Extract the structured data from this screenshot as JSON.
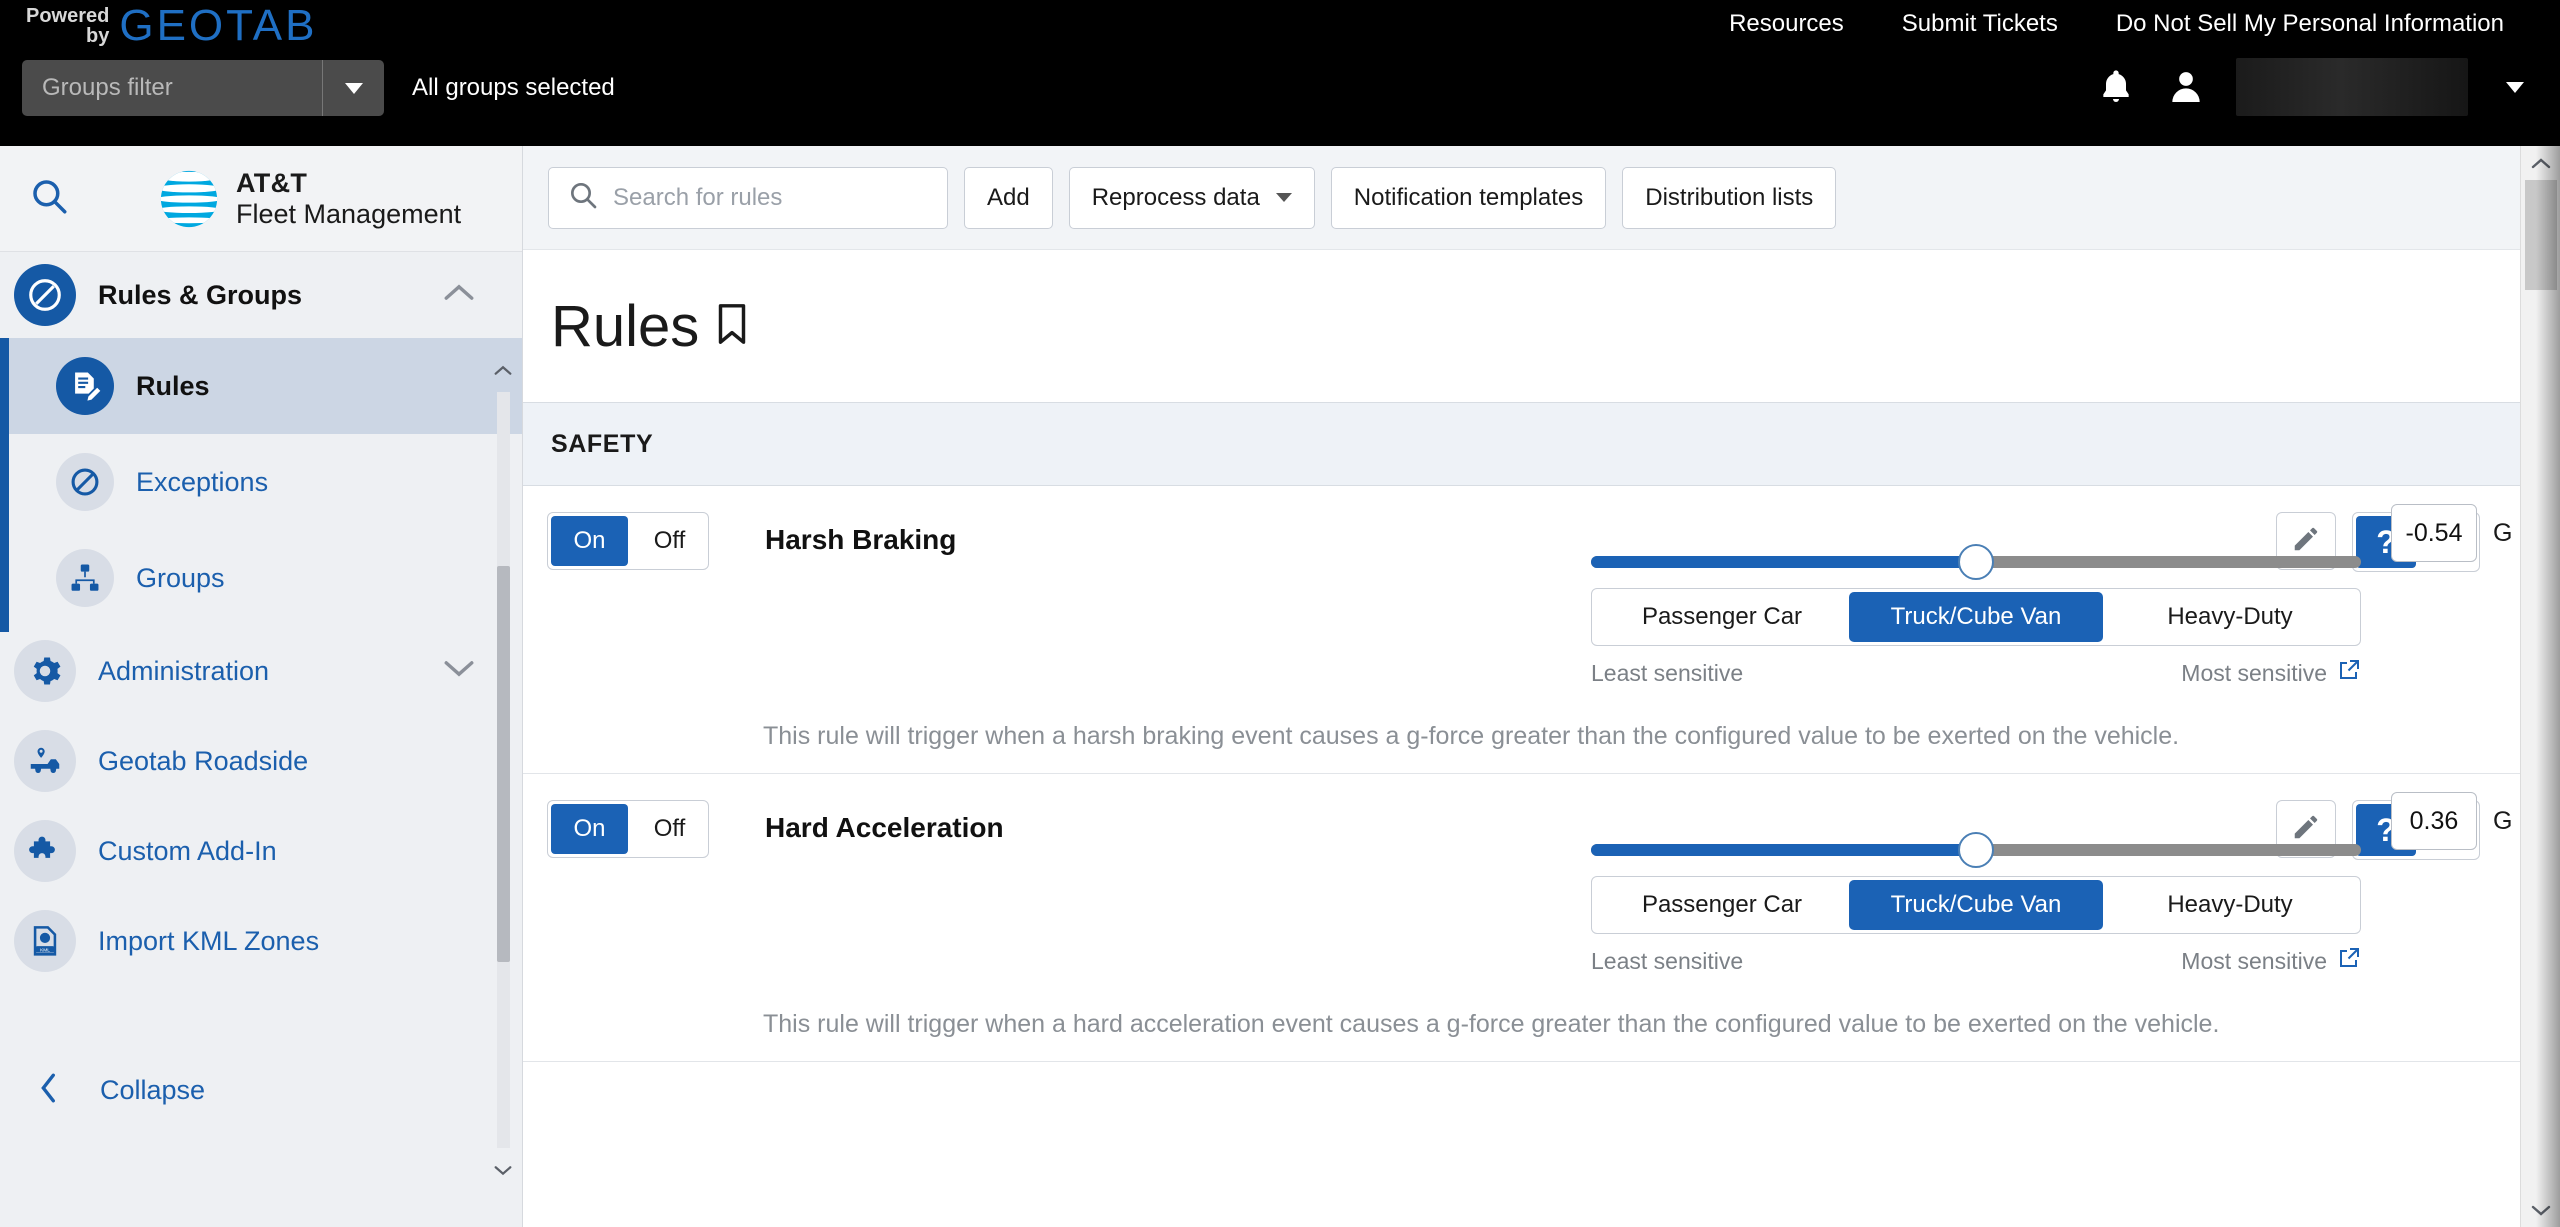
{
  "topbar": {
    "powered_line1": "Powered",
    "powered_line2": "by",
    "brand": "GEOTAB",
    "nav": [
      {
        "label": "Resources"
      },
      {
        "label": "Submit Tickets"
      },
      {
        "label": "Do Not Sell My Personal Information"
      }
    ],
    "groups_filter_placeholder": "Groups filter",
    "groups_status": "All groups selected",
    "bell_icon": "bell-icon",
    "avatar_icon": "user-avatar-icon",
    "user_name": ""
  },
  "sidebar": {
    "search_icon": "search-icon",
    "product_line1": "AT&T",
    "product_line2": "Fleet Management",
    "items": [
      {
        "label": "Rules & Groups",
        "icon": "rules-groups-icon",
        "state": "expanded",
        "chevron": "chevron-up-icon"
      },
      {
        "label": "Rules",
        "icon": "rules-icon",
        "state": "active"
      },
      {
        "label": "Exceptions",
        "icon": "exceptions-icon",
        "state": "default"
      },
      {
        "label": "Groups",
        "icon": "groups-icon",
        "state": "default"
      },
      {
        "label": "Administration",
        "icon": "gear-icon",
        "state": "collapsed",
        "chevron": "chevron-down-icon"
      },
      {
        "label": "Geotab Roadside",
        "icon": "roadside-truck-icon",
        "state": "default"
      },
      {
        "label": "Custom Add-In",
        "icon": "puzzle-piece-icon",
        "state": "default"
      },
      {
        "label": "Import KML Zones",
        "icon": "kml-file-icon",
        "state": "default"
      }
    ],
    "collapse_label": "Collapse",
    "collapse_icon": "chevron-left-icon"
  },
  "toolbar": {
    "search_placeholder": "Search for rules",
    "search_icon": "search-icon",
    "add_label": "Add",
    "reprocess_label": "Reprocess data",
    "reprocess_caret": "chevron-down-icon",
    "notification_templates_label": "Notification templates",
    "distribution_lists_label": "Distribution lists"
  },
  "page": {
    "title": "Rules",
    "bookmark_icon": "bookmark-icon",
    "section_label": "SAFETY"
  },
  "common": {
    "on_label": "On",
    "off_label": "Off",
    "least_sensitive": "Least sensitive",
    "most_sensitive": "Most sensitive",
    "external_link_icon": "external-link-icon",
    "edit_icon": "pencil-icon",
    "help_icon": "question-mark-icon",
    "email_icon": "envelope-icon",
    "unit": "G",
    "vehicle_types": [
      "Passenger Car",
      "Truck/Cube Van",
      "Heavy-Duty"
    ]
  },
  "rules": [
    {
      "name": "Harsh Braking",
      "toggle": "On",
      "value": "-0.54",
      "unit": "G",
      "slider_percent": 50,
      "selected_vehicle_type": "Truck/Cube Van",
      "description": "This rule will trigger when a harsh braking event causes a g-force greater than the configured value to be exerted on the vehicle.",
      "help_active": true
    },
    {
      "name": "Hard Acceleration",
      "toggle": "On",
      "value": "0.36",
      "unit": "G",
      "slider_percent": 50,
      "selected_vehicle_type": "Truck/Cube Van",
      "description": "This rule will trigger when a hard acceleration event causes a g-force greater than the configured value to be exerted on the vehicle.",
      "help_active": true
    }
  ],
  "colors": {
    "accent_blue": "#1b62b5",
    "icon_blue": "#1559a5",
    "geotab_blue": "#1f6fc4",
    "slider_track": "#8c8c8c"
  }
}
